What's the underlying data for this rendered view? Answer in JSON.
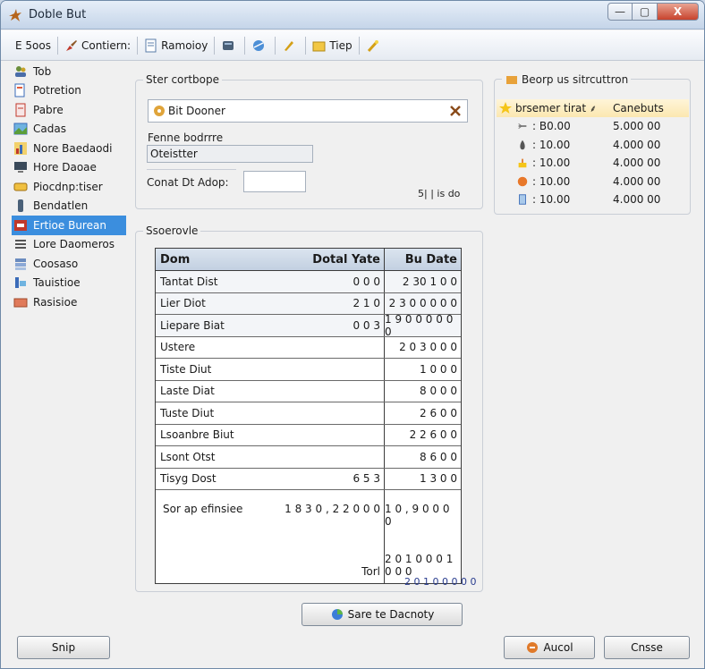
{
  "window": {
    "title": "Doble But",
    "buttons": {
      "minimize": "—",
      "maximize": "▢",
      "close": "X"
    }
  },
  "toolbar": {
    "items": [
      "E 5oos",
      "Contiern:",
      "Ramoioy",
      "",
      "",
      "",
      "Tiep",
      ""
    ]
  },
  "sidebar": {
    "items": [
      {
        "label": "Tob",
        "icon": "people-icon"
      },
      {
        "label": "Potretion",
        "icon": "doc-icon"
      },
      {
        "label": "Pabre",
        "icon": "page-icon"
      },
      {
        "label": "Cadas",
        "icon": "image-icon"
      },
      {
        "label": "Nore Baedaodi",
        "icon": "chart-icon"
      },
      {
        "label": "Hore Daoae",
        "icon": "monitor-icon"
      },
      {
        "label": "Piocdnp:tiser",
        "icon": "drive-icon"
      },
      {
        "label": "Bendatlen",
        "icon": "bottle-icon"
      },
      {
        "label": "Ertioe Burean",
        "icon": "tool-icon"
      },
      {
        "label": "Lore Daomeros",
        "icon": "list-icon"
      },
      {
        "label": "Coosaso",
        "icon": "stack-icon"
      },
      {
        "label": "Tauistioe",
        "icon": "tag-icon"
      },
      {
        "label": "Rasisioe",
        "icon": "folder-icon"
      }
    ],
    "selected_index": 8
  },
  "search_group": {
    "title": "Ster cortbope",
    "input_value": "Bit Dooner",
    "section_label": "Fenne bodrrre",
    "sub_field_value": "Oteistter",
    "amount_label": "Conat Dt Adop:",
    "amount_value": "",
    "note": "5| | is do"
  },
  "side_table": {
    "title": "Beorp us sitrcuttron",
    "col1": "brsemer tirat",
    "col2": "Canebuts",
    "rows": [
      {
        "c1": ": B0.00",
        "c2": "5.000 00",
        "icon": "fork-icon"
      },
      {
        "c1": ": 10.00",
        "c2": "4.000 00",
        "icon": "drop-icon"
      },
      {
        "c1": ": 10.00",
        "c2": "4.000 00",
        "icon": "cake-icon"
      },
      {
        "c1": ": 10.00",
        "c2": "4.000 00",
        "icon": "ball-icon"
      },
      {
        "c1": ": 10.00",
        "c2": "4.000 00",
        "icon": "glass-icon"
      }
    ]
  },
  "results_group": {
    "title": "Ssoerovle",
    "headers": [
      "Dom",
      "Dotal Yate",
      "Bu Date"
    ],
    "rows": [
      [
        "Tantat Dist",
        "0 0 0",
        "2 30 1 0 0"
      ],
      [
        "Lier Diot",
        "2 1 0",
        "2 3 0 0 0 0 0"
      ],
      [
        "Liepare Biat",
        "0 0 3",
        "1 9 0 0 0 0 0 0"
      ],
      [
        "Ustere",
        "",
        "2 0 3 0 0 0"
      ],
      [
        "Tiste Diut",
        "",
        "1 0 0 0"
      ],
      [
        "Laste Diat",
        "",
        "8 0 0 0"
      ],
      [
        "Tuste Diut",
        "",
        "2 6 0 0"
      ],
      [
        "Lsoanbre Biut",
        "",
        "2 2 6 0 0"
      ],
      [
        "Lsont Otst",
        "",
        "8 6 0 0"
      ],
      [
        "Tisyg Dost",
        "6 5 3",
        "1 3 0 0"
      ]
    ],
    "summary": {
      "label": "Sor ap efinsiee",
      "total": "1 8 3 0 , 2 2 0 0 0",
      "value": "1 0 , 9 0 0 0 0"
    },
    "footer_label": "Torl",
    "footer_value": "2 0 1 0 0 0 1 0 0 0",
    "grand_total": "2 0 1 0 0 0 0 0"
  },
  "buttons": {
    "save": "Sare te Dacnoty",
    "help": "Snip",
    "cancel": "Aucol",
    "close": "Cnsse"
  }
}
